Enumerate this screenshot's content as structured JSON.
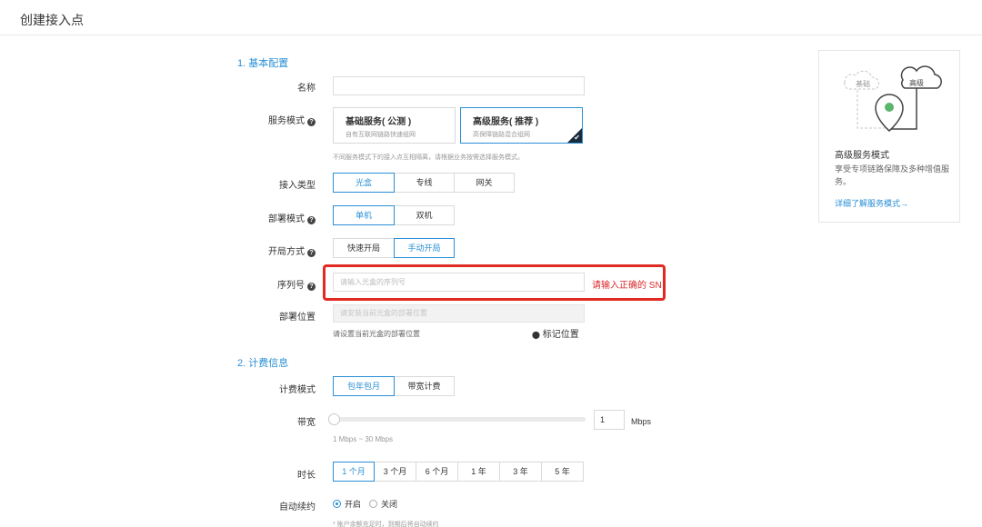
{
  "page": {
    "title": "创建接入点"
  },
  "section1": {
    "title": "1. 基本配置"
  },
  "name_field": {
    "label": "名称",
    "value": ""
  },
  "service_mode": {
    "label": "服务模式",
    "cards": [
      {
        "title": "基础服务( 公测 )",
        "subtitle": "自有互联网链路快速组网",
        "selected": false
      },
      {
        "title": "高级服务( 推荐 )",
        "subtitle": "高保障链路混合组网",
        "selected": true
      }
    ],
    "hint": "不同服务模式下的接入点互相隔离，请根据业务按需选择服务模式。"
  },
  "access_type": {
    "label": "接入类型",
    "options": [
      "光盒",
      "专线",
      "网关"
    ],
    "selected": "光盒"
  },
  "deploy_mode": {
    "label": "部署模式",
    "options": [
      "单机",
      "双机"
    ],
    "selected": "单机"
  },
  "open_mode": {
    "label": "开局方式",
    "options": [
      "快速开局",
      "手动开局"
    ],
    "selected": "手动开局"
  },
  "serial": {
    "label": "序列号",
    "placeholder": "请输入光盒的序列号",
    "error": "请输入正确的 SN"
  },
  "location": {
    "label": "部署位置",
    "placeholder": "请安装当前光盒的部署位置",
    "hint": "请设置当前光盒的部署位置",
    "mark_label": "标记位置"
  },
  "section2": {
    "title": "2. 计费信息"
  },
  "billing_mode": {
    "label": "计费模式",
    "options": [
      "包年包月",
      "带宽计费"
    ],
    "selected": "包年包月"
  },
  "bandwidth": {
    "label": "带宽",
    "value": "1",
    "unit": "Mbps",
    "range_hint": "1 Mbps ~ 30 Mbps",
    "slider_fraction": 0
  },
  "duration": {
    "label": "时长",
    "options": [
      "1 个月",
      "3 个月",
      "6 个月",
      "1 年",
      "3 年",
      "5 年"
    ],
    "selected": "1 个月"
  },
  "auto_renew": {
    "label": "自动续约",
    "options": [
      "开启",
      "关闭"
    ],
    "selected": "开启",
    "hint": "* 账户余额充足时，到期后将自动续约"
  },
  "side_card": {
    "illustration_labels": [
      "基础",
      "高级"
    ],
    "title": "高级服务模式",
    "description": "享受专项链路保障及多种增值服务。",
    "link": "详细了解服务模式→"
  },
  "colors": {
    "accent": "#2a8fd6",
    "error": "#d9282a",
    "highlight_box": "#e02a22"
  }
}
